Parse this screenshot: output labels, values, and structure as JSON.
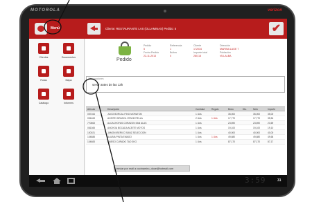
{
  "device": {
    "brand": "MOTOROLA",
    "carrier": "verizon"
  },
  "header": {
    "menu_label": "Menú",
    "client_line": "Cliente: RESTAURANTE LAS (OLLAMINAS)  Pedido: 5",
    "check_glyph": "✔"
  },
  "sidebar": {
    "items": [
      {
        "label": "Clientes",
        "icon": "clients-icon"
      },
      {
        "label": "Documentos",
        "icon": "documents-icon"
      },
      {
        "label": "Rutas",
        "icon": "routes-icon"
      },
      {
        "label": "Mapa",
        "icon": "map-icon"
      },
      {
        "label": "Catálogo",
        "icon": "catalog-icon"
      },
      {
        "label": "Informes",
        "icon": "reports-icon"
      }
    ]
  },
  "order": {
    "title": "Pedido",
    "fields": [
      {
        "label": "Pedido",
        "value": "5"
      },
      {
        "label": "Fecha Pedido",
        "value": "22-11-2013"
      },
      {
        "label": "Referencia",
        "value": "1"
      },
      {
        "label": "Bultos",
        "value": "0"
      },
      {
        "label": "Cliente",
        "value": "172034"
      },
      {
        "label": "Importe total",
        "value": "280,18"
      },
      {
        "label": "Dirección",
        "value": "MARINA LAGE 7"
      },
      {
        "label": "Población",
        "value": "VILLALBA"
      }
    ]
  },
  "observations": {
    "title": "Observaciones",
    "text": "servir antes de las 13h"
  },
  "items_table": {
    "columns": [
      "Artículo",
      "Descripción",
      "Cantidad",
      "Regalo",
      "Bruto",
      "Dto.",
      "Neto",
      "Importe"
    ],
    "rows": [
      [
        "057164",
        "JUGO BORCAL FINO MORATON",
        "1 Uds",
        "",
        "35,000",
        "",
        "35,000",
        "35,00"
      ],
      [
        "051463",
        "ACEITE GIRASOL VEN BOTELLA",
        "2 Uds",
        "1 Uds",
        "17,770",
        "",
        "17,770",
        "35,54"
      ],
      [
        "770663",
        "ALCACHOFAS CORAZON SAN ALAS",
        "1 Uds",
        "",
        "23,690",
        "",
        "23,690",
        "23,69"
      ],
      [
        "081365",
        "ANCHOA BOCADA ACEITE MOTOS",
        "1 Uds",
        "",
        "19,100",
        "",
        "19,100",
        "19,10"
      ],
      [
        "100021",
        "JAMON IBERICO SANZ SELECCION",
        "1 Uds",
        "",
        "40,000",
        "",
        "40,000",
        "40,00"
      ],
      [
        "104888",
        "ALUBIA PINTA EMAGO",
        "1 Uds",
        "1 Uds",
        "49,680",
        "",
        "49,680",
        "49,68"
      ],
      [
        "104683",
        "QUESO CURADO TAO 3KG",
        "1 Uds",
        "",
        "87,170",
        "",
        "87,170",
        "87,17"
      ]
    ]
  },
  "email": {
    "text": "enviar por mail a cocinamiro_doce@hotmail.com"
  },
  "statusbar": {
    "clock": "3:59",
    "ampm": "31"
  }
}
